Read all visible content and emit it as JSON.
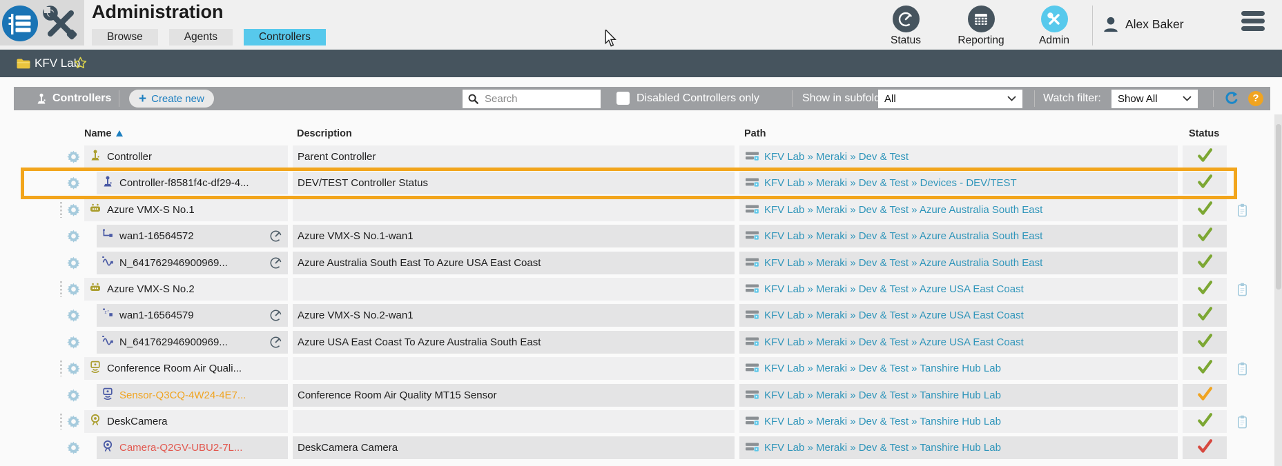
{
  "header": {
    "title": "Administration",
    "tabs": [
      {
        "label": "Browse",
        "active": false
      },
      {
        "label": "Agents",
        "active": false
      },
      {
        "label": "Controllers",
        "active": true
      }
    ],
    "nav": [
      {
        "label": "Status",
        "icon": "gauge-icon",
        "active": false
      },
      {
        "label": "Reporting",
        "icon": "report-icon",
        "active": false
      },
      {
        "label": "Admin",
        "icon": "tools-icon",
        "active": true
      }
    ],
    "user": "Alex Baker"
  },
  "breadcrumb": {
    "label": "KFV Lab"
  },
  "toolbar": {
    "section_label": "Controllers",
    "create_plus": "+",
    "create_label": "Create new",
    "search_placeholder": "Search",
    "checkbox_label": "Disabled Controllers only",
    "subfolders_label": "Show in subfolders:",
    "subfolders_value": "All",
    "watch_label": "Watch filter:",
    "watch_value": "Show All",
    "help_label": "?"
  },
  "table": {
    "columns": [
      "Name",
      "Description",
      "Path",
      "Status"
    ],
    "rows": [
      {
        "name": "Controller",
        "name_color": "dark",
        "icon": "joystick",
        "icon_color": "olive",
        "level": 0,
        "drag": false,
        "gauge": false,
        "clipboard": false,
        "highlight": false,
        "desc": "Parent Controller",
        "path": "KFV Lab » Meraki » Dev & Test",
        "status": "ok"
      },
      {
        "name": "Controller-f8581f4c-df29-4...",
        "name_color": "dark",
        "icon": "joystick",
        "icon_color": "blue",
        "level": 1,
        "drag": false,
        "gauge": false,
        "clipboard": false,
        "highlight": true,
        "desc": "DEV/TEST Controller Status",
        "path": "KFV Lab » Meraki » Dev & Test » Devices - DEV/TEST",
        "status": "ok"
      },
      {
        "name": "Azure VMX-S No.1",
        "name_color": "dark",
        "icon": "robot",
        "icon_color": "olive",
        "level": 0,
        "drag": true,
        "gauge": false,
        "clipboard": true,
        "highlight": false,
        "desc": "",
        "path": "KFV Lab » Meraki » Dev & Test » Azure Australia South East",
        "status": "ok"
      },
      {
        "name": "wan1-16564572",
        "name_color": "dark",
        "icon": "wan",
        "icon_color": "blue",
        "level": 1,
        "drag": false,
        "gauge": true,
        "clipboard": false,
        "highlight": false,
        "desc": "Azure VMX-S No.1-wan1",
        "path": "KFV Lab » Meraki » Dev & Test » Azure Australia South East",
        "status": "ok"
      },
      {
        "name": "N_641762946900969...",
        "name_color": "dark",
        "icon": "wave",
        "icon_color": "blue",
        "level": 1,
        "drag": false,
        "gauge": true,
        "clipboard": false,
        "highlight": false,
        "desc": "Azure Australia South East To Azure USA East Coast",
        "path": "KFV Lab » Meraki » Dev & Test » Azure Australia South East",
        "status": "ok"
      },
      {
        "name": "Azure VMX-S No.2",
        "name_color": "dark",
        "icon": "robot",
        "icon_color": "olive",
        "level": 0,
        "drag": true,
        "gauge": false,
        "clipboard": true,
        "highlight": false,
        "desc": "",
        "path": "KFV Lab » Meraki » Dev & Test » Azure USA East Coast",
        "status": "ok"
      },
      {
        "name": "wan1-16564579",
        "name_color": "dark",
        "icon": "wanz",
        "icon_color": "blue",
        "level": 1,
        "drag": false,
        "gauge": true,
        "clipboard": false,
        "highlight": false,
        "desc": "Azure VMX-S No.2-wan1",
        "path": "KFV Lab » Meraki » Dev & Test » Azure USA East Coast",
        "status": "ok"
      },
      {
        "name": "N_641762946900969...",
        "name_color": "dark",
        "icon": "wave",
        "icon_color": "blue",
        "level": 1,
        "drag": false,
        "gauge": true,
        "clipboard": false,
        "highlight": false,
        "desc": "Azure USA East Coast To Azure Australia South East",
        "path": "KFV Lab » Meraki » Dev & Test » Azure USA East Coast",
        "status": "ok"
      },
      {
        "name": "Conference Room Air Quali...",
        "name_color": "dark",
        "icon": "sensor",
        "icon_color": "olive",
        "level": 0,
        "drag": true,
        "gauge": false,
        "clipboard": true,
        "highlight": false,
        "desc": "",
        "path": "KFV Lab » Meraki » Dev & Test » Tanshire Hub Lab",
        "status": "ok"
      },
      {
        "name": "Sensor-Q3CQ-4W24-4E7...",
        "name_color": "orange",
        "icon": "sensor",
        "icon_color": "blue",
        "level": 1,
        "drag": false,
        "gauge": false,
        "clipboard": false,
        "highlight": false,
        "desc": "Conference Room Air Quality MT15 Sensor",
        "path": "KFV Lab » Meraki » Dev & Test » Tanshire Hub Lab",
        "status": "warning"
      },
      {
        "name": "DeskCamera",
        "name_color": "dark",
        "icon": "camera",
        "icon_color": "olive",
        "level": 0,
        "drag": true,
        "gauge": false,
        "clipboard": true,
        "highlight": false,
        "desc": "",
        "path": "KFV Lab » Meraki » Dev & Test » Tanshire Hub Lab",
        "status": "ok"
      },
      {
        "name": "Camera-Q2GV-UBU2-7L...",
        "name_color": "red",
        "icon": "camera",
        "icon_color": "blue",
        "level": 1,
        "drag": false,
        "gauge": false,
        "clipboard": false,
        "highlight": false,
        "desc": "DeskCamera Camera",
        "path": "KFV Lab » Meraki » Dev & Test » Tanshire Hub Lab",
        "status": "error"
      }
    ]
  },
  "colors": {
    "accent_cyan": "#57c9ec",
    "dark_slate": "#46545e",
    "toolbar_gray": "#9d9fa2",
    "link_teal": "#2f95ba",
    "accent_blue": "#1d7fc0",
    "status_ok": "#7ca733",
    "status_warning": "#f0a421",
    "status_error": "#d6483f",
    "icon_olive": "#ab9e2f",
    "icon_blue": "#4a5aa5",
    "gear_blue": "#a6cbdd",
    "highlight_border": "#f2a51c",
    "folder_yellow": "#e9c43e"
  }
}
